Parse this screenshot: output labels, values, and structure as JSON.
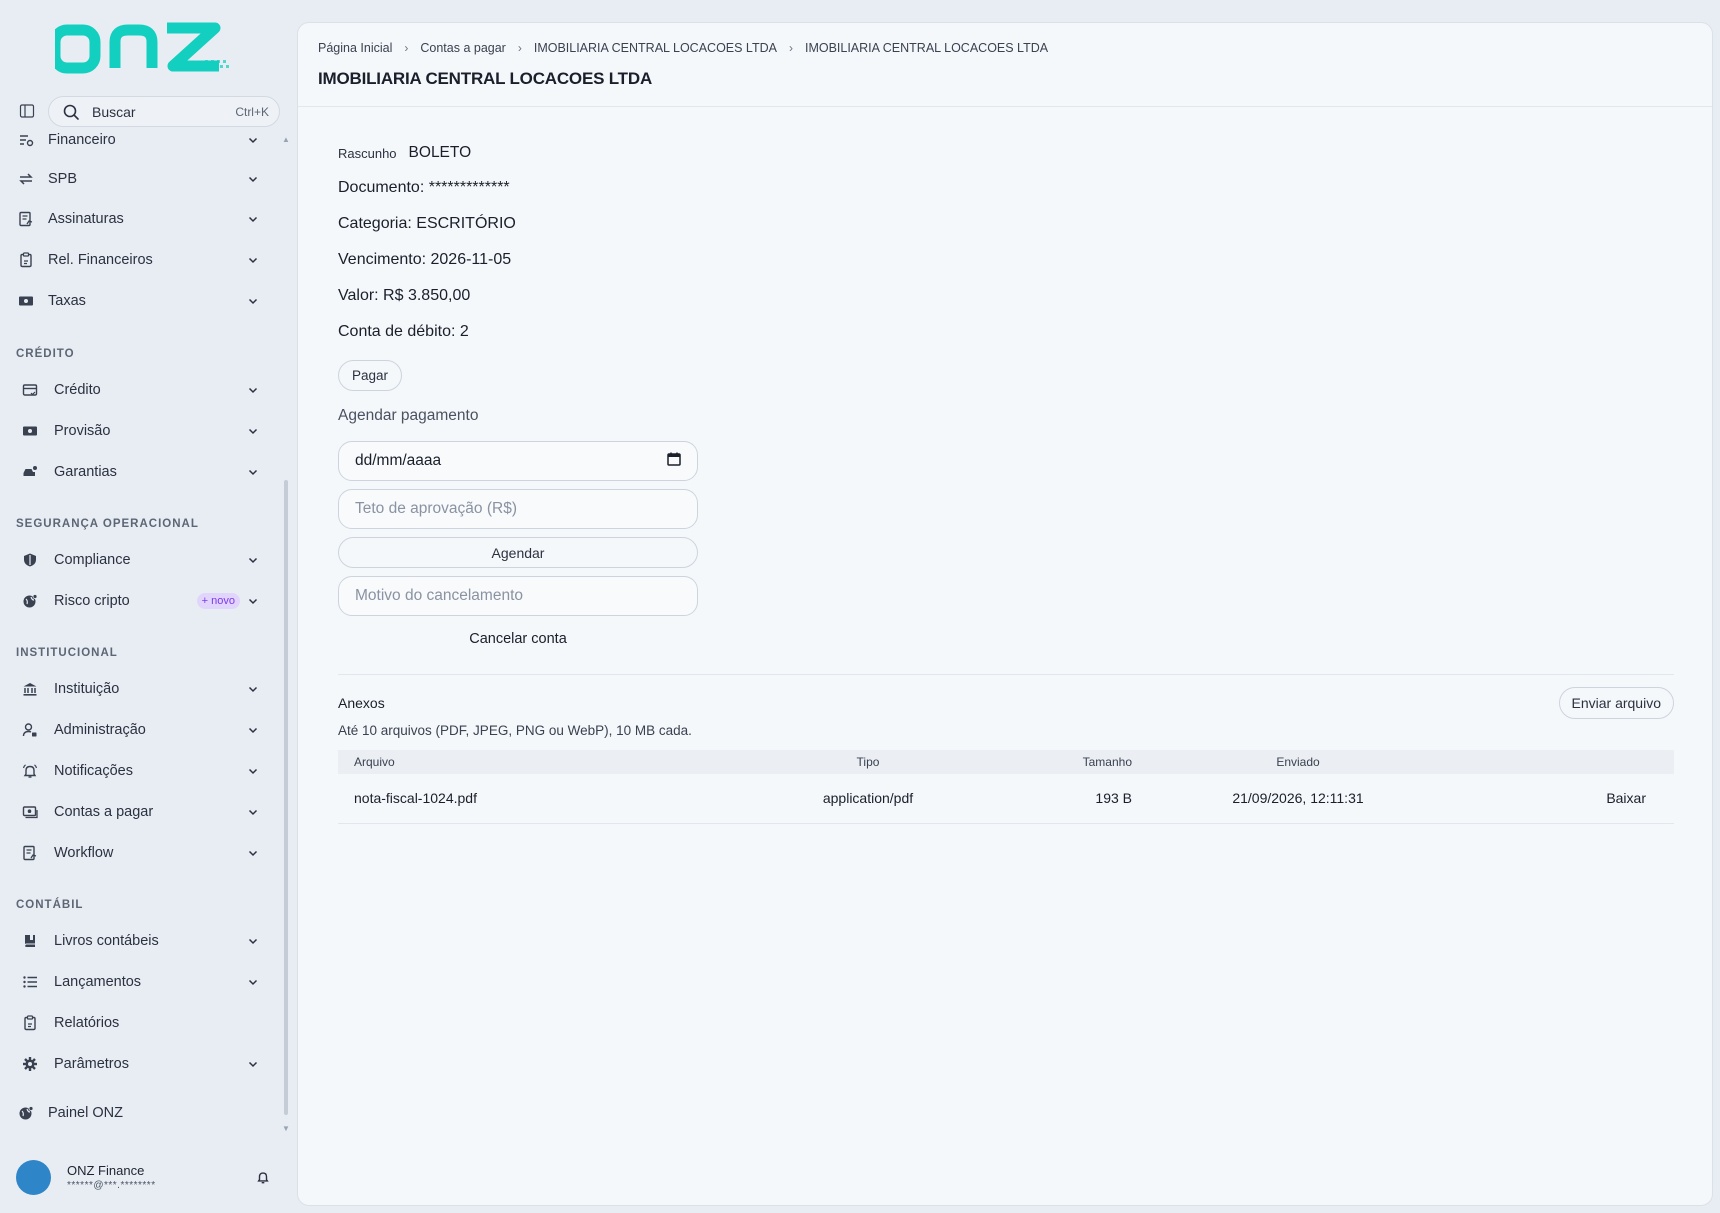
{
  "brand": {
    "logo_text": "onz",
    "accent": "#13cfbf"
  },
  "search": {
    "label": "Buscar",
    "shortcut": "Ctrl+K"
  },
  "sidebar": {
    "partial_item": "Financeiro",
    "group_top": [
      "SPB",
      "Assinaturas",
      "Rel. Financeiros",
      "Taxas"
    ],
    "section_credito": "CRÉDITO",
    "credito": [
      "Crédito",
      "Provisão",
      "Garantias"
    ],
    "section_seguranca": "SEGURANÇA OPERACIONAL",
    "seguranca": [
      "Compliance",
      "Risco cripto"
    ],
    "novo_badge": "+ novo",
    "section_institucional": "INSTITUCIONAL",
    "institucional": [
      "Instituição",
      "Administração",
      "Notificações",
      "Contas a pagar",
      "Workflow"
    ],
    "section_contabil": "CONTÁBIL",
    "contabil": [
      "Livros contábeis",
      "Lançamentos",
      "Relatórios",
      "Parâmetros"
    ],
    "painel": "Painel ONZ"
  },
  "user": {
    "name": "ONZ Finance",
    "email": "******@***.********"
  },
  "breadcrumb": [
    "Página Inicial",
    "Contas a pagar",
    "IMOBILIARIA CENTRAL LOCACOES LTDA",
    "IMOBILIARIA CENTRAL LOCACOES LTDA"
  ],
  "page_title": "IMOBILIARIA CENTRAL LOCACOES LTDA",
  "bill": {
    "status": "Rascunho",
    "kind": "BOLETO",
    "documento": "Documento: *************",
    "categoria": "Categoria: ESCRITÓRIO",
    "vencimento": "Vencimento: 2026-11-05",
    "valor": "Valor: R$ 3.850,00",
    "conta": "Conta de débito: 2"
  },
  "actions": {
    "pagar": "Pagar",
    "agendar_title": "Agendar pagamento",
    "date_placeholder": "dd/mm/aaaa",
    "teto_placeholder": "Teto de aprovação (R$)",
    "agendar": "Agendar",
    "motivo_placeholder": "Motivo do cancelamento",
    "cancelar": "Cancelar conta"
  },
  "anexos": {
    "title": "Anexos",
    "upload": "Enviar arquivo",
    "help": "Até 10 arquivos (PDF, JPEG, PNG ou WebP), 10 MB cada.",
    "columns": [
      "Arquivo",
      "Tipo",
      "Tamanho",
      "Enviado"
    ],
    "rows": [
      {
        "arquivo": "nota-fiscal-1024.pdf",
        "tipo": "application/pdf",
        "tamanho": "193 B",
        "enviado": "21/09/2026, 12:11:31",
        "acao": "Baixar"
      }
    ]
  }
}
